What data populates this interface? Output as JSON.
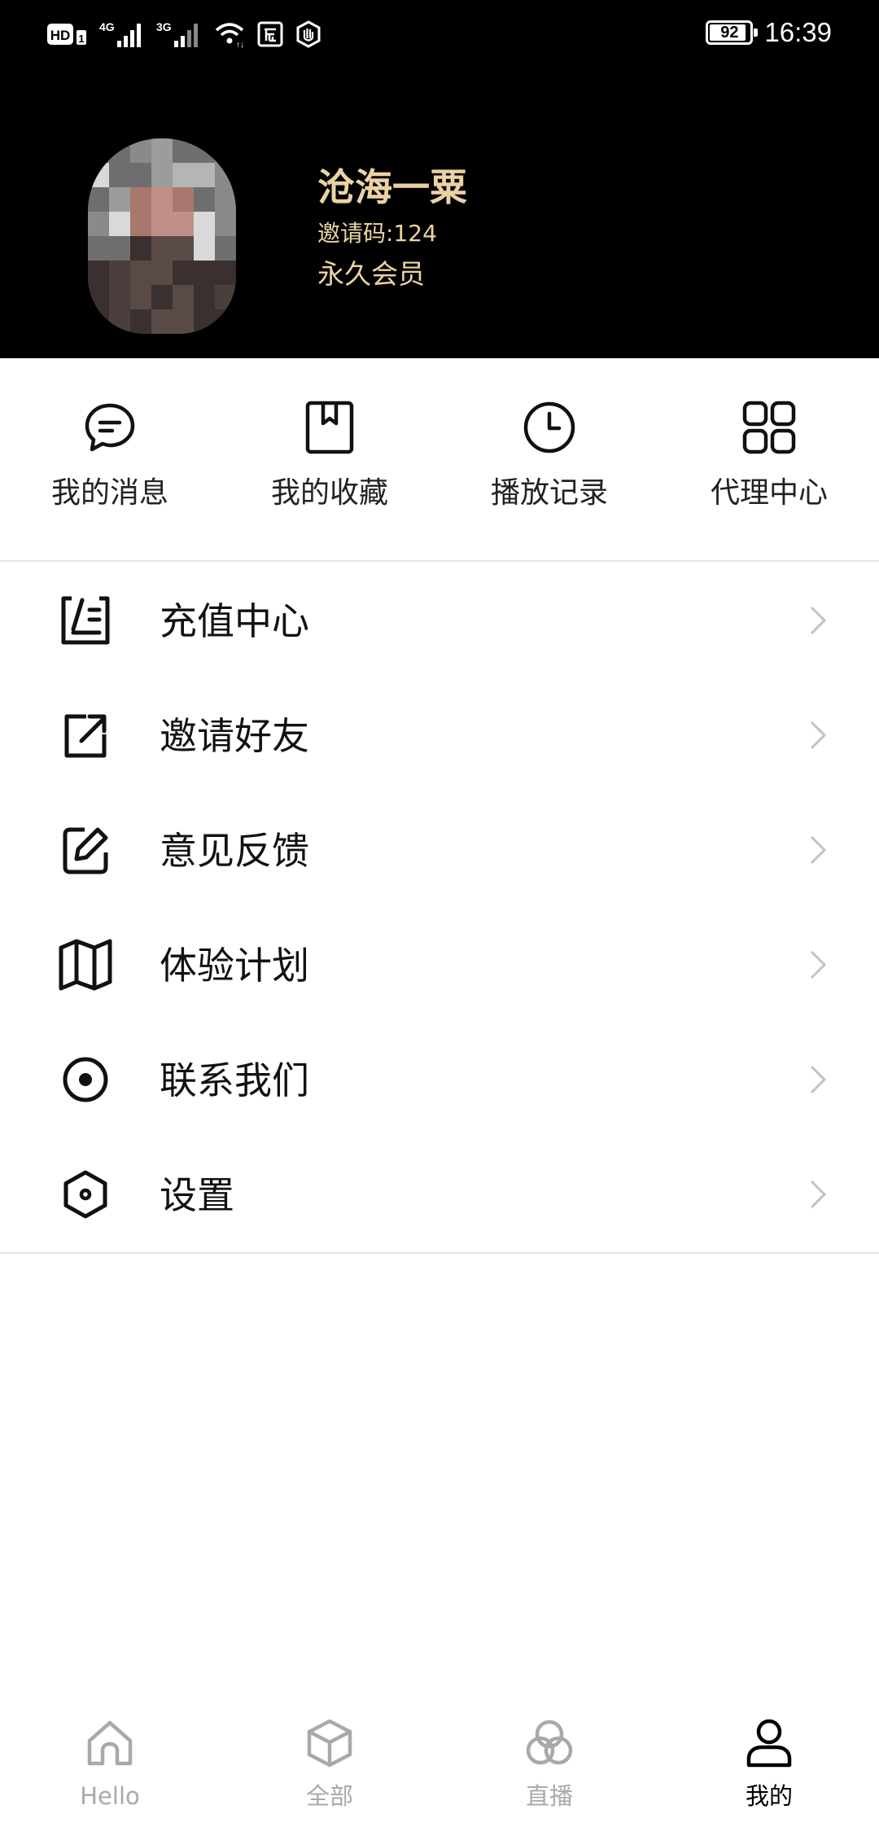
{
  "status_bar": {
    "left_icons": [
      "hd-icon",
      "signal-4g-icon",
      "signal-3g-icon",
      "wifi-icon",
      "store-icon",
      "hand-icon"
    ],
    "signal_4g_label": "4G",
    "signal_3g_label": "3G",
    "battery_level": "92",
    "time": "16:39"
  },
  "profile": {
    "avatar": "avatar-photo-pixelated",
    "name": "沧海一粟",
    "invite_code": "邀请码:124",
    "member_level": "永久会员"
  },
  "quick_actions": [
    {
      "label": "我的消息",
      "icon": "message-icon"
    },
    {
      "label": "我的收藏",
      "icon": "bookmark-icon"
    },
    {
      "label": "播放记录",
      "icon": "clock-icon"
    },
    {
      "label": "代理中心",
      "icon": "grid-icon"
    }
  ],
  "menu": [
    {
      "label": "充值中心",
      "icon": "recharge-icon"
    },
    {
      "label": "邀请好友",
      "icon": "share-icon"
    },
    {
      "label": "意见反馈",
      "icon": "edit-icon"
    },
    {
      "label": "体验计划",
      "icon": "map-icon"
    },
    {
      "label": "联系我们",
      "icon": "radio-icon"
    },
    {
      "label": "设置",
      "icon": "settings-icon"
    }
  ],
  "tabs": [
    {
      "label": "Hello",
      "icon": "home-icon",
      "active": false
    },
    {
      "label": "全部",
      "icon": "cube-icon",
      "active": false
    },
    {
      "label": "直播",
      "icon": "circles-icon",
      "active": false
    },
    {
      "label": "我的",
      "icon": "user-icon",
      "active": true
    }
  ],
  "colors": {
    "header_bg": "#000000",
    "accent_gold": "#ecd3a3",
    "tab_inactive": "#a9a9a9",
    "tab_active": "#000000"
  }
}
